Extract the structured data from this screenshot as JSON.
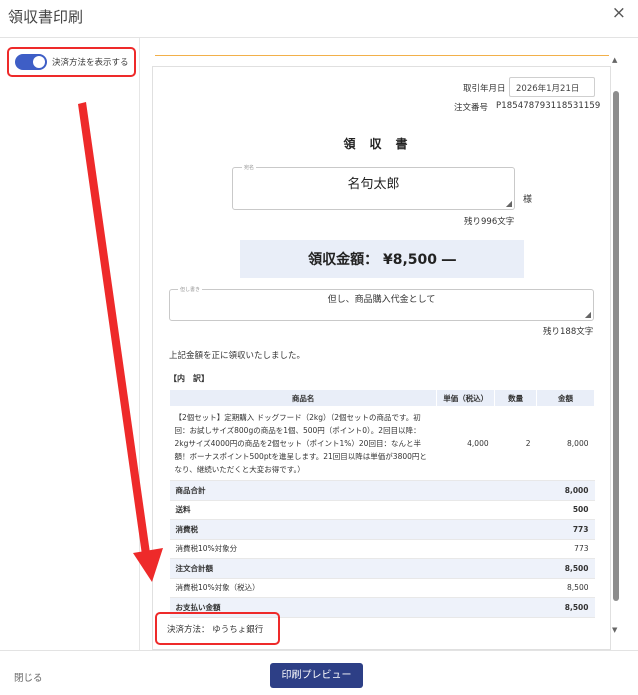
{
  "dialog": {
    "title": "領収書印刷",
    "close_symbol": "×"
  },
  "options": {
    "show_payment_method_label": "決済方法を表示する",
    "show_payment_method": true
  },
  "receipt": {
    "date_label": "取引年月日",
    "date_value": "2026年1月21日",
    "order_label": "注文番号",
    "order_number": "P185478793118531159",
    "title": "領収書",
    "name_legend": "宛名",
    "name_value": "名句太郎",
    "honorific": "様",
    "name_remaining": "残り996文字",
    "amount_text": "領収金額： ¥8,500 ―",
    "purpose_legend": "但し書き",
    "purpose_value": "但し、商品購入代金として",
    "purpose_remaining": "残り188文字",
    "received_text": "上記金額を正に領収いたしました。",
    "breakdown_label": "【内　訳】",
    "table_headers": {
      "name": "商品名",
      "unit_price": "単価（税込）",
      "qty": "数量",
      "amount": "金額"
    },
    "item": {
      "name": "【2個セット】定期購入 ドッグフード（2kg）（2個セットの商品です。初回：お試しサイズ800gの商品を1個、500円（ポイント0）。2回目以降：2kgサイズ4000円の商品を2個セット（ポイント1%）20回目：なんと半額！ボーナスポイント500ptを進呈します。21回目以降は単価が3800円となり、継続いただくと大変お得です。）",
      "unit_price": "4,000",
      "qty": "2",
      "amount": "8,000"
    },
    "summary": [
      {
        "label": "商品合計",
        "value": "8,000",
        "bold": true,
        "shade": true
      },
      {
        "label": "送料",
        "value": "500",
        "bold": true,
        "shade": false
      },
      {
        "label": "消費税",
        "value": "773",
        "bold": true,
        "shade": true
      },
      {
        "label": "消費税10%対象分",
        "value": "773",
        "bold": false,
        "shade": false
      },
      {
        "label": "注文合計額",
        "value": "8,500",
        "bold": true,
        "shade": true
      },
      {
        "label": "消費税10%対象（税込）",
        "value": "8,500",
        "bold": false,
        "shade": false
      },
      {
        "label": "お支払い金額",
        "value": "8,500",
        "bold": true,
        "shade": true
      }
    ],
    "payment_method_text": "決済方法：  ゆうちょ銀行"
  },
  "footer": {
    "close_label": "閉じる",
    "print_preview_label": "印刷プレビュー"
  },
  "colors": {
    "accent": "#2d3f86",
    "toggle": "#3e5ec6",
    "highlight": "#ee2a2a",
    "table_header": "#e9eef8"
  }
}
